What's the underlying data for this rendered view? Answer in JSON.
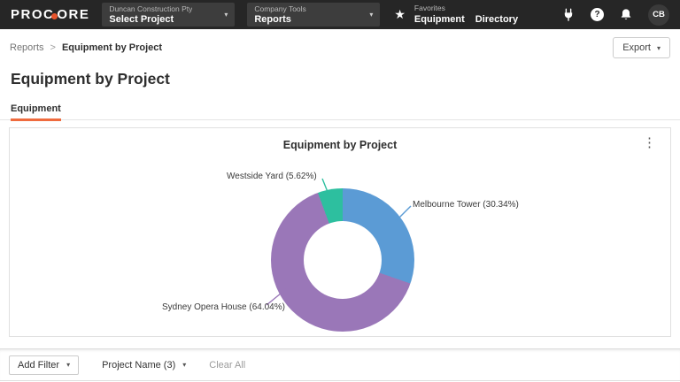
{
  "topbar": {
    "logo_parts": [
      "PROC",
      "ORE"
    ],
    "project_picker": {
      "label": "Duncan Construction Pty",
      "value": "Select Project"
    },
    "tools_picker": {
      "label": "Company Tools",
      "value": "Reports"
    },
    "favorites": {
      "label": "Favorites",
      "links": [
        "Equipment",
        "Directory"
      ]
    },
    "user_initials": "CB",
    "icon_names": [
      "marketplace-plug",
      "help",
      "notifications"
    ]
  },
  "breadcrumb": {
    "items": [
      "Reports",
      "Equipment by Project"
    ]
  },
  "export_button": {
    "label": "Export"
  },
  "page_title": "Equipment by Project",
  "tabs": [
    {
      "label": "Equipment",
      "active": true
    }
  ],
  "card": {
    "title": "Equipment by Project"
  },
  "chart_data": {
    "type": "pie",
    "title": "Equipment by Project",
    "donut": true,
    "start_angle_deg": 0,
    "direction": "clockwise",
    "slices": [
      {
        "name": "Melbourne Tower",
        "pct": 30.34,
        "label": "Melbourne Tower (30.34%)",
        "color": "#5b9bd5"
      },
      {
        "name": "Sydney Opera House",
        "pct": 64.04,
        "label": "Sydney Opera House (64.04%)",
        "color": "#9a77b8"
      },
      {
        "name": "Westside Yard",
        "pct": 5.62,
        "label": "Westside Yard (5.62%)",
        "color": "#2dbf9f"
      }
    ]
  },
  "filters": {
    "add_filter_label": "Add Filter",
    "active_filter_label": "Project Name (3)",
    "clear_all_label": "Clear All"
  },
  "colors": {
    "accent_orange": "#ef6b3e",
    "logo_dot_orange": "#e8542c",
    "topbar_bg": "#262626"
  }
}
